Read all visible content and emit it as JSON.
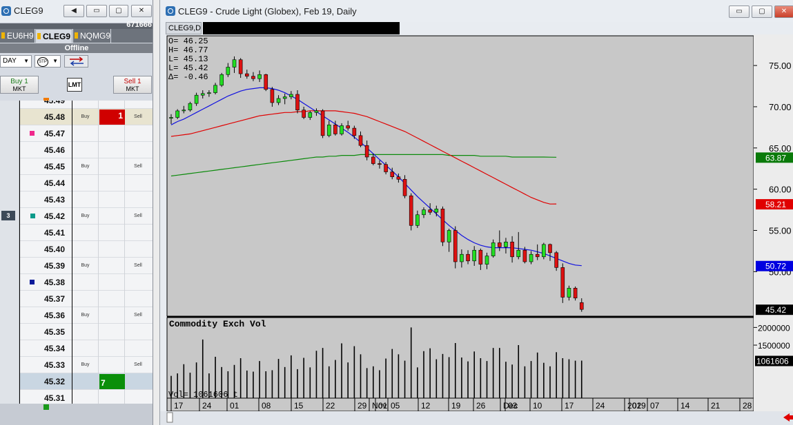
{
  "dom_window": {
    "title": "CLEG9",
    "buttons": {
      "back": "◀",
      "minimize": "▭",
      "restore": "▢",
      "close": "✕"
    },
    "account": "671666",
    "tabs": [
      {
        "label": "EU6H9",
        "active": false
      },
      {
        "label": "CLEG9",
        "active": true
      },
      {
        "label": "NQMG9",
        "active": false
      }
    ],
    "status": "Offline",
    "duration": "DAY",
    "stp_label": "STP",
    "buy_button": {
      "main": "Buy 1",
      "sub": "MKT"
    },
    "sell_button": {
      "main": "Sell 1",
      "sub": "MKT"
    },
    "lmt_label": "LMT",
    "ladder": [
      {
        "price": "45.49",
        "buy": "",
        "sell": ""
      },
      {
        "price": "45.48",
        "buy": "Buy",
        "sell": "Sell",
        "qty": "1"
      },
      {
        "price": "45.47",
        "buy": "",
        "sell": ""
      },
      {
        "price": "45.46",
        "buy": "",
        "sell": ""
      },
      {
        "price": "45.45",
        "buy": "Buy",
        "sell": "Sell"
      },
      {
        "price": "45.44",
        "buy": "",
        "sell": ""
      },
      {
        "price": "45.43",
        "buy": "",
        "sell": ""
      },
      {
        "price": "45.42",
        "buy": "Buy",
        "sell": "Sell",
        "left": "3"
      },
      {
        "price": "45.41",
        "buy": "",
        "sell": ""
      },
      {
        "price": "45.40",
        "buy": "",
        "sell": ""
      },
      {
        "price": "45.39",
        "buy": "Buy",
        "sell": "Sell"
      },
      {
        "price": "45.38",
        "buy": "",
        "sell": ""
      },
      {
        "price": "45.37",
        "buy": "",
        "sell": ""
      },
      {
        "price": "45.36",
        "buy": "Buy",
        "sell": "Sell"
      },
      {
        "price": "45.35",
        "buy": "",
        "sell": ""
      },
      {
        "price": "45.34",
        "buy": "",
        "sell": ""
      },
      {
        "price": "45.33",
        "buy": "Buy",
        "sell": "Sell"
      },
      {
        "price": "45.32",
        "buy": "",
        "sell": "",
        "qty": "7"
      },
      {
        "price": "45.31",
        "buy": "",
        "sell": ""
      }
    ]
  },
  "chart_window": {
    "title": "CLEG9 - Crude Light (Globex), Feb 19, Daily",
    "tab": "CLEG9,D",
    "ohlc": {
      "o": "O=   46.25",
      "h": "H=   46.77",
      "l1": "L=   45.13",
      "l2": "L=   45.42",
      "d": "Δ=   -0.46"
    },
    "volume_title": "Commodity Exch Vol",
    "volume_readout": "Vol=   1061606 t",
    "price_axis": [
      "75.00",
      "70.00",
      "65.00",
      "60.00",
      "55.00",
      "50.00"
    ],
    "price_tags": [
      {
        "label": "63.87",
        "color": "#0a7a0a",
        "value": 63.87
      },
      {
        "label": "58.21",
        "color": "#e00000",
        "value": 58.21
      },
      {
        "label": "50.72",
        "color": "#0000e0",
        "value": 50.72
      },
      {
        "label": "45.42",
        "color": "#000000",
        "value": 45.42
      }
    ],
    "volume_axis": [
      "2000000",
      "1500000"
    ],
    "volume_tag": "1061606",
    "date_labels": [
      "17",
      "24",
      "01",
      "08",
      "15",
      "22",
      "29",
      "Nov",
      "01",
      "05",
      "12",
      "19",
      "26",
      "Dec",
      "03",
      "10",
      "17",
      "24",
      "2019",
      "02",
      "07",
      "14",
      "21",
      "28"
    ]
  },
  "chart_data": {
    "type": "candlestick",
    "candles": [
      [
        68.6,
        69.1,
        67.9,
        68.7
      ],
      [
        68.7,
        69.7,
        68.5,
        69.5
      ],
      [
        69.5,
        70.1,
        69.2,
        69.6
      ],
      [
        69.6,
        70.6,
        69.4,
        70.4
      ],
      [
        70.4,
        71.7,
        70.1,
        71.4
      ],
      [
        71.4,
        72.0,
        71.0,
        71.6
      ],
      [
        71.6,
        72.0,
        71.2,
        71.7
      ],
      [
        71.7,
        72.9,
        71.5,
        72.6
      ],
      [
        72.6,
        74.1,
        72.4,
        73.9
      ],
      [
        73.9,
        75.3,
        73.6,
        74.8
      ],
      [
        74.8,
        76.1,
        74.1,
        75.7
      ],
      [
        75.7,
        75.9,
        73.5,
        74.0
      ],
      [
        74.0,
        74.5,
        73.4,
        73.7
      ],
      [
        73.7,
        74.2,
        73.1,
        73.4
      ],
      [
        73.4,
        74.4,
        73.0,
        73.9
      ],
      [
        73.9,
        74.0,
        71.9,
        72.1
      ],
      [
        72.1,
        72.4,
        70.0,
        70.5
      ],
      [
        70.5,
        71.4,
        70.2,
        71.0
      ],
      [
        71.0,
        71.6,
        70.3,
        71.2
      ],
      [
        71.2,
        71.9,
        70.9,
        71.5
      ],
      [
        71.5,
        72.0,
        69.2,
        69.6
      ],
      [
        69.6,
        70.0,
        68.5,
        68.7
      ],
      [
        68.7,
        69.5,
        68.4,
        69.3
      ],
      [
        69.3,
        69.8,
        68.9,
        69.5
      ],
      [
        69.5,
        69.7,
        66.2,
        66.5
      ],
      [
        66.5,
        68.3,
        66.3,
        67.8
      ],
      [
        67.8,
        68.3,
        66.5,
        66.7
      ],
      [
        66.7,
        68.0,
        66.5,
        67.7
      ],
      [
        67.7,
        68.3,
        67.1,
        67.4
      ],
      [
        67.4,
        67.7,
        66.1,
        66.5
      ],
      [
        66.5,
        67.0,
        65.1,
        65.3
      ],
      [
        65.3,
        65.9,
        63.5,
        63.9
      ],
      [
        63.9,
        64.3,
        62.9,
        63.1
      ],
      [
        63.1,
        63.5,
        62.5,
        63.0
      ],
      [
        63.0,
        63.3,
        61.8,
        62.1
      ],
      [
        62.1,
        62.6,
        61.2,
        61.5
      ],
      [
        61.5,
        61.9,
        60.8,
        61.2
      ],
      [
        61.2,
        61.7,
        58.9,
        59.2
      ],
      [
        59.2,
        59.5,
        55.0,
        55.6
      ],
      [
        55.6,
        57.4,
        55.3,
        56.9
      ],
      [
        56.9,
        57.8,
        56.5,
        57.5
      ],
      [
        57.5,
        58.3,
        56.9,
        57.2
      ],
      [
        57.2,
        58.0,
        56.7,
        57.6
      ],
      [
        57.6,
        57.9,
        53.1,
        53.6
      ],
      [
        53.6,
        55.2,
        52.4,
        55.0
      ],
      [
        55.0,
        55.5,
        50.4,
        51.2
      ],
      [
        51.2,
        52.7,
        50.5,
        52.1
      ],
      [
        52.1,
        52.6,
        50.9,
        51.3
      ],
      [
        51.3,
        53.1,
        50.7,
        52.6
      ],
      [
        52.6,
        52.8,
        50.2,
        50.9
      ],
      [
        50.9,
        52.3,
        50.3,
        51.9
      ],
      [
        51.9,
        53.9,
        51.7,
        53.5
      ],
      [
        53.5,
        55.0,
        52.5,
        53.0
      ],
      [
        53.0,
        54.1,
        52.2,
        53.6
      ],
      [
        53.6,
        54.3,
        51.1,
        51.8
      ],
      [
        51.8,
        54.8,
        51.5,
        52.6
      ],
      [
        52.6,
        53.0,
        51.0,
        51.2
      ],
      [
        51.2,
        52.5,
        50.9,
        52.1
      ],
      [
        52.1,
        53.3,
        51.4,
        51.8
      ],
      [
        51.8,
        53.5,
        51.5,
        53.3
      ],
      [
        53.3,
        53.4,
        51.3,
        52.3
      ],
      [
        52.3,
        52.5,
        50.1,
        50.5
      ],
      [
        50.5,
        51.0,
        46.2,
        46.9
      ],
      [
        46.9,
        48.3,
        46.5,
        48.0
      ],
      [
        48.0,
        48.2,
        46.5,
        46.8
      ],
      [
        46.25,
        46.77,
        45.13,
        45.42
      ]
    ],
    "sma_blue": [
      67.8,
      68.2,
      68.5,
      68.9,
      69.3,
      69.7,
      70.1,
      70.5,
      70.9,
      71.3,
      71.6,
      71.9,
      72.1,
      72.2,
      72.3,
      72.3,
      72.2,
      72.0,
      71.7,
      71.3,
      70.9,
      70.4,
      69.9,
      69.4,
      68.9,
      68.4,
      67.9,
      67.4,
      66.9,
      66.3,
      65.7,
      65.0,
      64.3,
      63.6,
      62.9,
      62.2,
      61.5,
      60.7,
      59.9,
      59.1,
      58.4,
      57.7,
      57.0,
      56.3,
      55.6,
      55.0,
      54.4,
      53.9,
      53.5,
      53.2,
      53.0,
      52.9,
      52.9,
      52.9,
      52.9,
      52.8,
      52.7,
      52.6,
      52.4,
      52.2,
      51.9,
      51.6,
      51.3,
      51.0,
      50.8,
      50.72
    ],
    "sma_red": [
      66.4,
      66.5,
      66.6,
      66.7,
      66.9,
      67.1,
      67.3,
      67.5,
      67.7,
      67.9,
      68.1,
      68.3,
      68.5,
      68.7,
      68.9,
      69.0,
      69.1,
      69.2,
      69.3,
      69.3,
      69.4,
      69.4,
      69.5,
      69.5,
      69.5,
      69.5,
      69.5,
      69.4,
      69.3,
      69.2,
      69.0,
      68.8,
      68.5,
      68.2,
      67.9,
      67.6,
      67.3,
      67.0,
      66.6,
      66.2,
      65.8,
      65.4,
      65.0,
      64.6,
      64.2,
      63.8,
      63.4,
      63.0,
      62.6,
      62.2,
      61.8,
      61.4,
      61.0,
      60.6,
      60.2,
      59.8,
      59.4,
      59.0,
      58.7,
      58.4,
      58.2,
      58.21
    ],
    "sma_green": [
      61.6,
      61.7,
      61.8,
      61.9,
      62.0,
      62.1,
      62.2,
      62.3,
      62.4,
      62.5,
      62.6,
      62.7,
      62.8,
      62.9,
      63.0,
      63.1,
      63.2,
      63.3,
      63.4,
      63.5,
      63.6,
      63.7,
      63.8,
      63.9,
      63.9,
      64.0,
      64.0,
      64.1,
      64.1,
      64.1,
      64.2,
      64.2,
      64.2,
      64.2,
      64.2,
      64.2,
      64.2,
      64.2,
      64.2,
      64.2,
      64.2,
      64.2,
      64.2,
      64.2,
      64.1,
      64.1,
      64.1,
      64.1,
      64.1,
      64.0,
      64.0,
      64.0,
      64.0,
      64.0,
      63.9,
      63.9,
      63.9,
      63.9,
      63.9,
      63.9,
      63.88,
      63.87
    ],
    "volume": [
      630000,
      700000,
      960000,
      720000,
      1010000,
      1660000,
      700000,
      1170000,
      880000,
      760000,
      940000,
      1130000,
      780000,
      750000,
      1050000,
      760000,
      790000,
      1110000,
      880000,
      1210000,
      820000,
      1140000,
      870000,
      1340000,
      1420000,
      900000,
      1080000,
      1550000,
      1010000,
      1470000,
      1240000,
      850000,
      900000,
      790000,
      1120000,
      1390000,
      1240000,
      1060000,
      2000000,
      870000,
      1330000,
      1410000,
      1100000,
      1250000,
      1160000,
      1560000,
      1150000,
      1040000,
      1320000,
      1130000,
      1050000,
      1420000,
      1420000,
      1030000,
      950000,
      1500000,
      900000,
      1050000,
      1290000,
      1000000,
      900000,
      1300000,
      1130000,
      1100000,
      1060000,
      1061606
    ],
    "ylim_price": [
      44.6,
      78.6
    ],
    "ylim_volume": [
      0,
      2280000
    ]
  }
}
